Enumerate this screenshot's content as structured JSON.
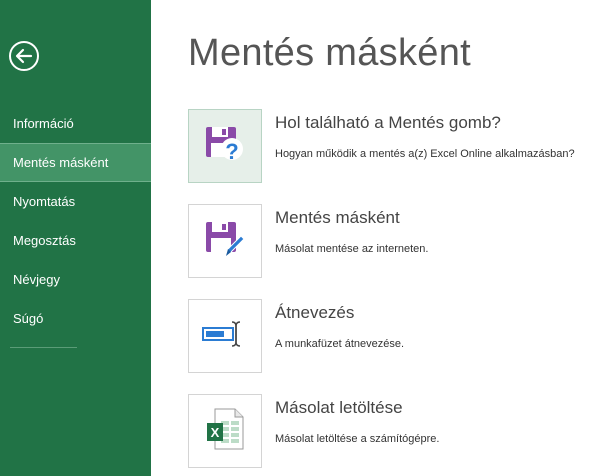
{
  "sidebar": {
    "back_icon": "back-arrow-icon",
    "items": [
      {
        "label": "Információ",
        "active": false
      },
      {
        "label": "Mentés másként",
        "active": true
      },
      {
        "label": "Nyomtatás",
        "active": false
      },
      {
        "label": "Megosztás",
        "active": false
      },
      {
        "label": "Névjegy",
        "active": false
      },
      {
        "label": "Súgó",
        "active": false
      }
    ]
  },
  "main": {
    "title": "Mentés másként",
    "options": [
      {
        "title": "Hol található a Mentés gomb?",
        "description": "Hogyan működik a mentés a(z) Excel Online alkalmazásban?",
        "icon": "save-question-icon"
      },
      {
        "title": "Mentés másként",
        "description": "Másolat mentése az interneten.",
        "icon": "save-edit-icon"
      },
      {
        "title": "Átnevezés",
        "description": "A munkafüzet átnevezése.",
        "icon": "rename-icon"
      },
      {
        "title": "Másolat letöltése",
        "description": "Másolat letöltése a számítógépre.",
        "icon": "excel-download-icon"
      }
    ]
  },
  "colors": {
    "sidebar_bg": "#217346",
    "sidebar_active": "#439467",
    "icon_purple": "#8a4aa8",
    "icon_blue": "#2b7cd3",
    "excel_green": "#217346"
  }
}
